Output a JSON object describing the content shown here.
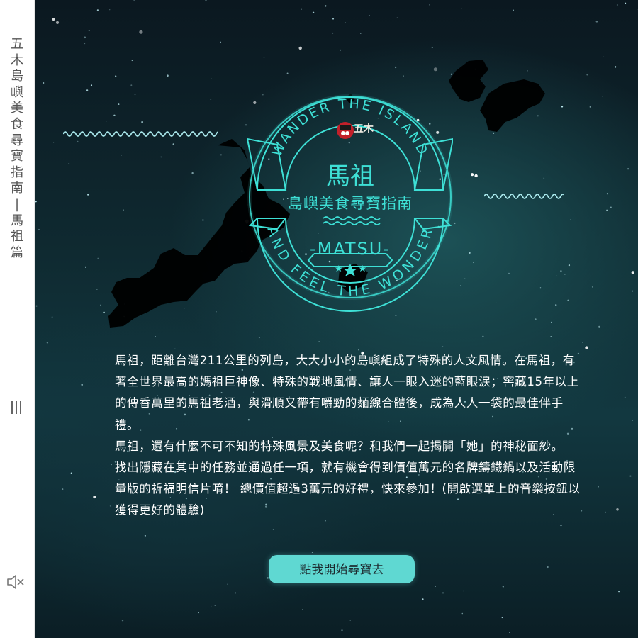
{
  "sidebar": {
    "title_chars": [
      "五",
      "木",
      "島",
      "嶼",
      "美",
      "食",
      "尋",
      "寶",
      "指",
      "南",
      "|",
      "馬",
      "祖",
      "篇"
    ],
    "menu_icon": "hamburger-vertical-icon",
    "sound_icon": "speaker-muted-icon"
  },
  "badge": {
    "top_arc_text": "WANDER THE ISLAND",
    "bottom_arc_text": "AND FEEL THE WONDER",
    "title": "馬祖",
    "subtitle": "島嶼美食尋寶指南",
    "ribbon_text": "-MATSU-",
    "logo_icon": "wumu-mascot-logo-icon",
    "accent_color": "#3ee0d6"
  },
  "description": {
    "p1": "馬祖，距離台灣211公里的列島，大大小小的島嶼組成了特殊的人文風情。在馬祖，有著全世界最高的媽祖巨神像、特殊的戰地風情、讓人一眼入迷的藍眼淚；窖藏15年以上的傳香萬里的馬祖老酒，與滑順又帶有嚼勁的麵線合體後，成為人人一袋的最佳伴手禮。",
    "p2": "馬祖，還有什麼不可不知的特殊風景及美食呢？和我們一起揭開「她」的神秘面紗。",
    "p3_underlined": "找出隱藏在其中的任務並通過任一項，",
    "p3_rest": "就有機會得到價值萬元的名牌鑄鐵鍋以及活動限量版的祈福明信片唷！ 總價值超過3萬元的好禮，快來參加！(開啟選單上的音樂按鈕以獲得更好的體驗)"
  },
  "start_button": {
    "label": "點我開始尋寶去"
  }
}
